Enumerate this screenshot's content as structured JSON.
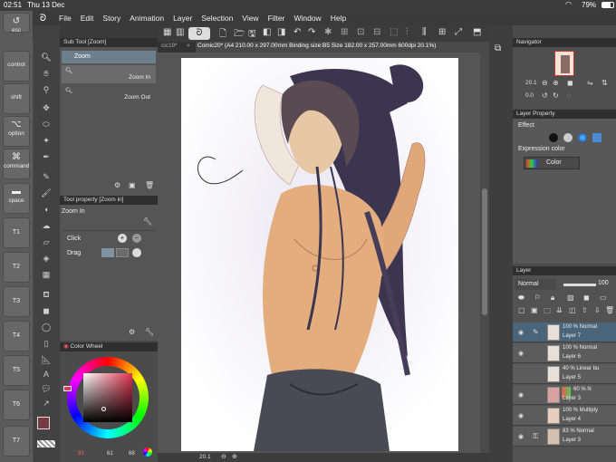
{
  "status": {
    "time": "02:51",
    "date": "Thu 13 Dec",
    "battery": "79%"
  },
  "menu": {
    "items": [
      "File",
      "Edit",
      "Story",
      "Animation",
      "Layer",
      "Selection",
      "View",
      "Filter",
      "Window",
      "Help"
    ]
  },
  "modifier_keys": [
    {
      "label": "esc",
      "icon": "undo-icon"
    },
    {
      "label": "control",
      "icon": ""
    },
    {
      "label": "shift",
      "icon": ""
    },
    {
      "label": "option",
      "icon": "option-key-icon"
    },
    {
      "label": "command",
      "icon": "command-key-icon"
    },
    {
      "label": "space",
      "icon": ""
    },
    {
      "label": "T1"
    },
    {
      "label": "T2"
    },
    {
      "label": "T3"
    },
    {
      "label": "T4"
    },
    {
      "label": "T5"
    },
    {
      "label": "T6"
    },
    {
      "label": "T7"
    }
  ],
  "sub_tool": {
    "title": "Sub Tool [Zoom]",
    "group": "Zoom",
    "items": [
      "Zoom In",
      "Zoom Out"
    ]
  },
  "tool_property": {
    "title": "Tool property [Zoom in]",
    "name": "Zoom In",
    "rows": [
      "Click",
      "Drag"
    ]
  },
  "color_wheel": {
    "title": "Color Wheel",
    "values": [
      "93",
      "61",
      "68"
    ],
    "main_color": "#7a3a44"
  },
  "document": {
    "tab_prev": "cic19*",
    "tab_title": "Comic20* (A4 210.00 x 297.00mm Binding size:B5 Size 182.00 x 257.00mm 600dpi 20.1%)",
    "zoom": "20.1"
  },
  "navigator": {
    "title": "Navigator",
    "zoom": "20.1",
    "angle": "0.0"
  },
  "layer_property": {
    "title": "Layer Property",
    "effect_label": "Effect",
    "expression_label": "Expression color",
    "expression_value": "Color"
  },
  "layer_panel": {
    "title": "Layer",
    "blend_mode": "Normal",
    "opacity": "100",
    "layers": [
      {
        "mode": "100 % Normal",
        "name": "Layer 7",
        "selected": true
      },
      {
        "mode": "100 % Normal",
        "name": "Layer 6",
        "selected": false
      },
      {
        "mode": "40 % Linear bu",
        "name": "Layer 5",
        "selected": false
      },
      {
        "mode": "60 % N",
        "name": "Layer 3",
        "selected": false
      },
      {
        "mode": "100 % Multiply",
        "name": "Layer 4",
        "selected": false
      },
      {
        "mode": "83 % Normal",
        "name": "Layer 3",
        "selected": false
      }
    ]
  },
  "colors": {
    "accent": "#4a6579",
    "background": "#4a4a4a"
  }
}
